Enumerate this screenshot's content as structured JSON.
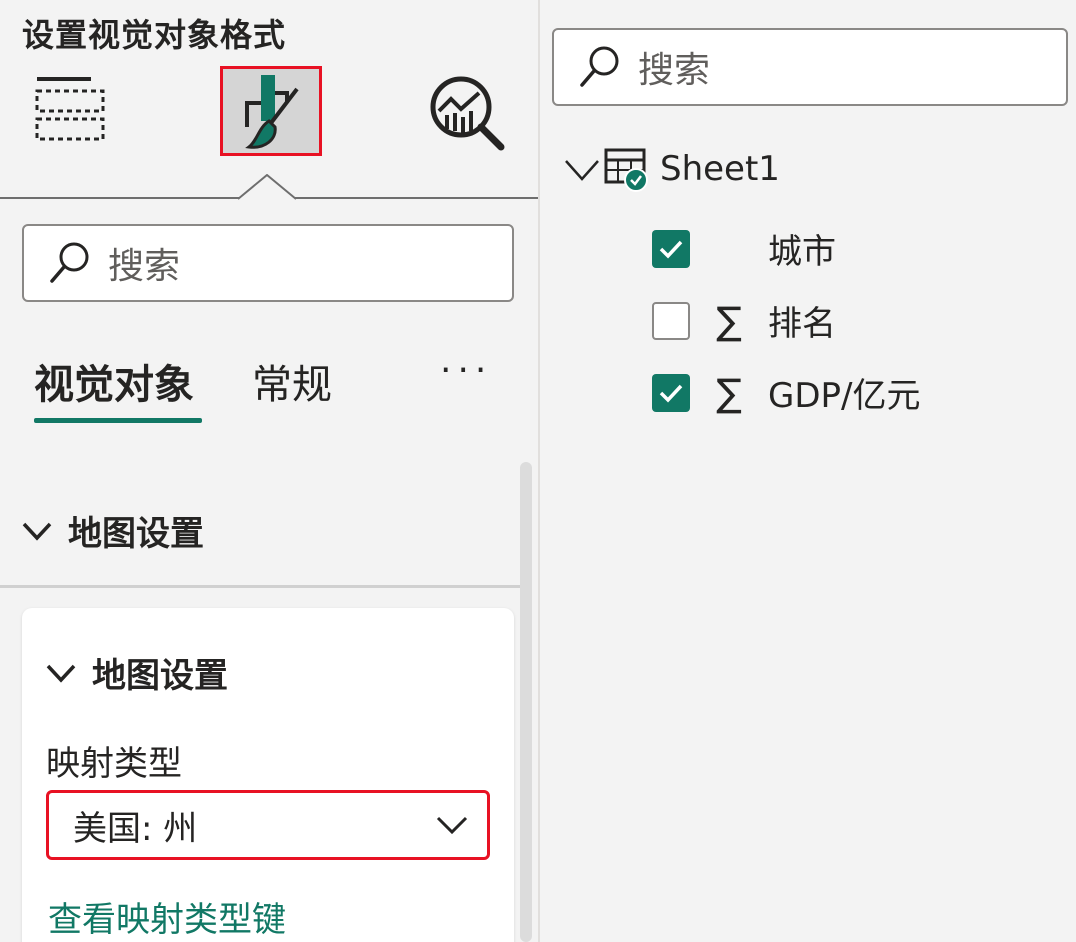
{
  "format_pane": {
    "title": "设置视觉对象格式",
    "tabs": [
      {
        "icon": "build-visual-icon",
        "selected": false
      },
      {
        "icon": "format-visual-icon",
        "selected": true
      },
      {
        "icon": "analytics-icon",
        "selected": false
      }
    ],
    "search": {
      "placeholder": "搜索"
    },
    "subtabs": {
      "visual": "视觉对象",
      "general": "常规",
      "more": "···"
    },
    "section": {
      "title": "地图设置"
    },
    "card": {
      "title": "地图设置",
      "field_label": "映射类型",
      "dropdown_value": "美国: 州",
      "link": "查看映射类型键"
    }
  },
  "data_pane": {
    "search": {
      "placeholder": "搜索"
    },
    "table": {
      "name": "Sheet1"
    },
    "fields": [
      {
        "name": "城市",
        "checked": true,
        "sigma": false
      },
      {
        "name": "排名",
        "checked": false,
        "sigma": true
      },
      {
        "name": "GDP/亿元",
        "checked": true,
        "sigma": true
      }
    ]
  },
  "colors": {
    "accent": "#117865",
    "highlight": "#e81123"
  }
}
